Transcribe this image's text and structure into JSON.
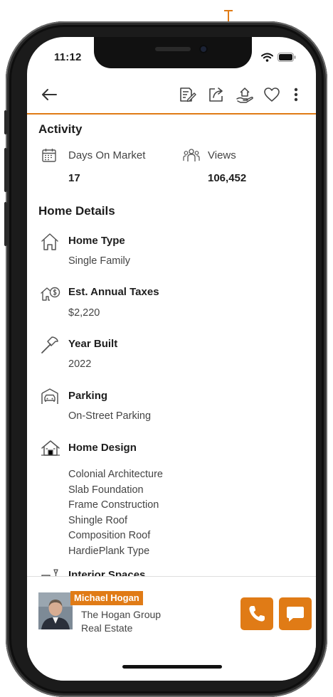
{
  "status": {
    "time": "11:12"
  },
  "activity": {
    "title": "Activity",
    "days_label": "Days On Market",
    "days_value": "17",
    "views_label": "Views",
    "views_value": "106,452"
  },
  "home_details": {
    "title": "Home Details",
    "home_type": {
      "label": "Home Type",
      "value": "Single Family"
    },
    "taxes": {
      "label": "Est. Annual Taxes",
      "value": "$2,220"
    },
    "year_built": {
      "label": "Year Built",
      "value": "2022"
    },
    "parking": {
      "label": "Parking",
      "value": "On-Street Parking"
    },
    "home_design": {
      "label": "Home Design",
      "values": [
        "Colonial Architecture",
        "Slab Foundation",
        "Frame Construction",
        "Shingle Roof",
        "Composition Roof",
        "HardiePlank Type"
      ]
    },
    "interior": {
      "label": "Interior Spaces"
    }
  },
  "agent": {
    "name": "Michael Hogan",
    "company_line1": "The Hogan Group",
    "company_line2": "Real Estate"
  },
  "icons": {
    "back": "arrow-left-icon",
    "notes": "notes-icon",
    "share": "share-icon",
    "offer": "hand-house-icon",
    "favorite": "heart-icon",
    "more": "more-vertical-icon",
    "calendar": "calendar-icon",
    "views": "people-icon",
    "home_type": "house-icon",
    "taxes": "house-dollar-icon",
    "year_built": "hammer-icon",
    "parking": "car-garage-icon",
    "home_design": "house-design-icon",
    "interior": "interior-icon",
    "call": "phone-icon",
    "chat": "chat-icon"
  },
  "colors": {
    "accent": "#e07b16",
    "text": "#1d1d1d",
    "muted": "#444444"
  }
}
